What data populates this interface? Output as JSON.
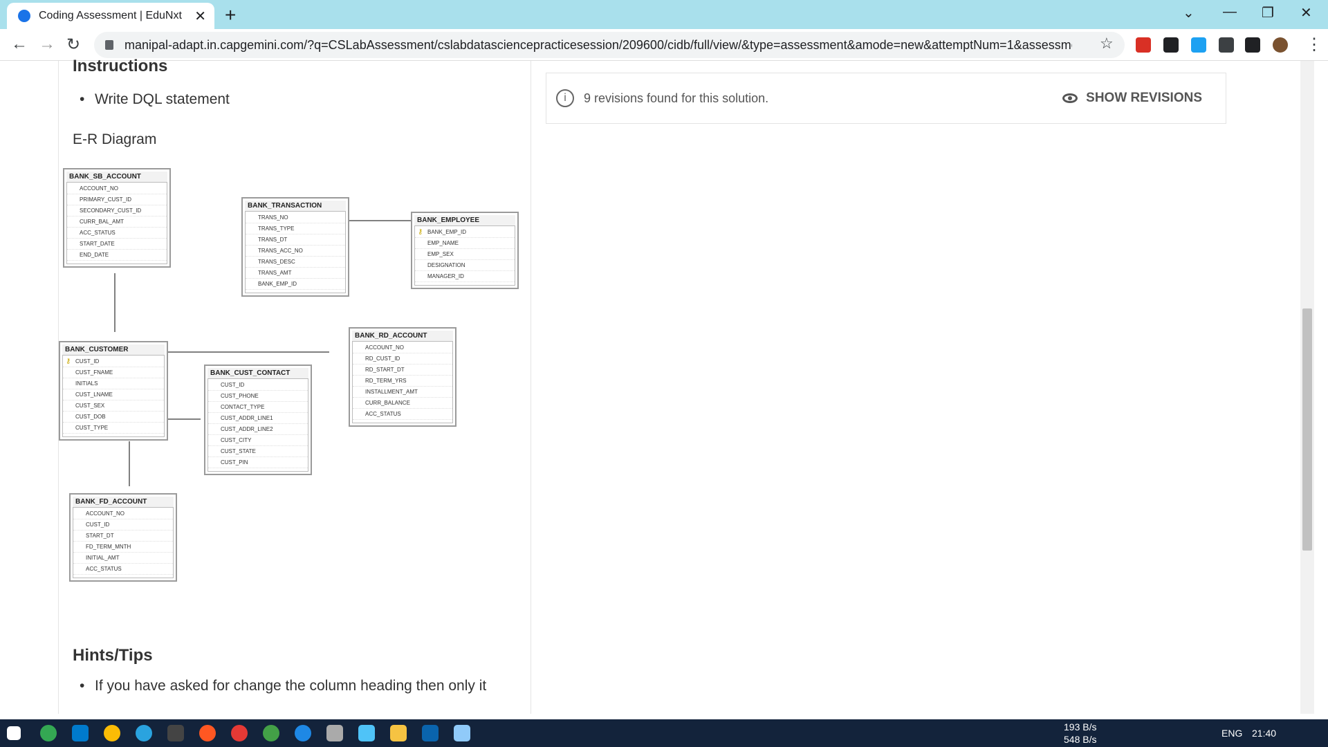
{
  "browser": {
    "tab_title": "Coding Assessment | EduNxt",
    "tab_close": "✕",
    "new_tab": "+",
    "url": "manipal-adapt.in.capgemini.com/?q=CSLabAssessment/cslabdatasciencepracticesession/209600/cidb/full/view/&type=assessment&amode=new&attemptNum=1&assessme..."
  },
  "left": {
    "instructions_heading": "Instructions",
    "instruction_items": [
      "Write DQL statement"
    ],
    "er_title": "E-R Diagram",
    "hints_heading": "Hints/Tips",
    "hint_items": [
      "If you have asked for change the column heading then only it"
    ]
  },
  "er_tables": [
    {
      "name": "BANK_SB_ACCOUNT",
      "cols": [
        "ACCOUNT_NO",
        "PRIMARY_CUST_ID",
        "SECONDARY_CUST_ID",
        "CURR_BAL_AMT",
        "ACC_STATUS",
        "START_DATE",
        "END_DATE"
      ],
      "pk": -1
    },
    {
      "name": "BANK_TRANSACTION",
      "cols": [
        "TRANS_NO",
        "TRANS_TYPE",
        "TRANS_DT",
        "TRANS_ACC_NO",
        "TRANS_DESC",
        "TRANS_AMT",
        "BANK_EMP_ID"
      ],
      "pk": -1
    },
    {
      "name": "BANK_EMPLOYEE",
      "cols": [
        "BANK_EMP_ID",
        "EMP_NAME",
        "EMP_SEX",
        "DESIGNATION",
        "MANAGER_ID"
      ],
      "pk": 0
    },
    {
      "name": "BANK_RD_ACCOUNT",
      "cols": [
        "ACCOUNT_NO",
        "RD_CUST_ID",
        "RD_START_DT",
        "RD_TERM_YRS",
        "INSTALLMENT_AMT",
        "CURR_BALANCE",
        "ACC_STATUS"
      ],
      "pk": -1
    },
    {
      "name": "BANK_CUSTOMER",
      "cols": [
        "CUST_ID",
        "CUST_FNAME",
        "INITIALS",
        "CUST_LNAME",
        "CUST_SEX",
        "CUST_DOB",
        "CUST_TYPE"
      ],
      "pk": 0
    },
    {
      "name": "BANK_CUST_CONTACT",
      "cols": [
        "CUST_ID",
        "CUST_PHONE",
        "CONTACT_TYPE",
        "CUST_ADDR_LINE1",
        "CUST_ADDR_LINE2",
        "CUST_CITY",
        "CUST_STATE",
        "CUST_PIN"
      ],
      "pk": -1
    },
    {
      "name": "BANK_FD_ACCOUNT",
      "cols": [
        "ACCOUNT_NO",
        "CUST_ID",
        "START_DT",
        "FD_TERM_MNTH",
        "INITIAL_AMT",
        "ACC_STATUS"
      ],
      "pk": -1
    }
  ],
  "right": {
    "revisions_text": "9 revisions found for this solution.",
    "show_revisions_label": "SHOW REVISIONS"
  },
  "taskbar": {
    "net_up": "193 B/s",
    "net_down": "548 B/s",
    "lang": "ENG",
    "time": "21:40"
  }
}
